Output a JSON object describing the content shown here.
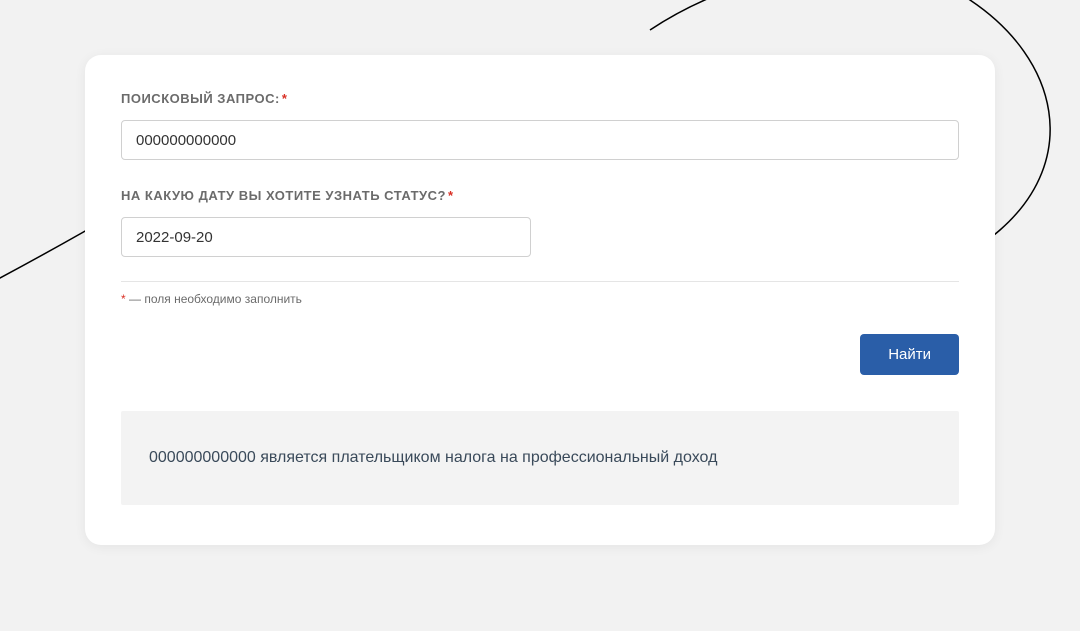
{
  "form": {
    "query_label": "ПОИСКОВЫЙ ЗАПРОС:",
    "query_value": "000000000000",
    "date_label": "НА КАКУЮ ДАТУ ВЫ ХОТИТЕ УЗНАТЬ СТАТУС?",
    "date_value": "2022-09-20",
    "required_hint": " — поля необходимо заполнить",
    "submit_label": "Найти"
  },
  "result": {
    "message": "000000000000 является плательщиком налога на профессиональный доход"
  }
}
